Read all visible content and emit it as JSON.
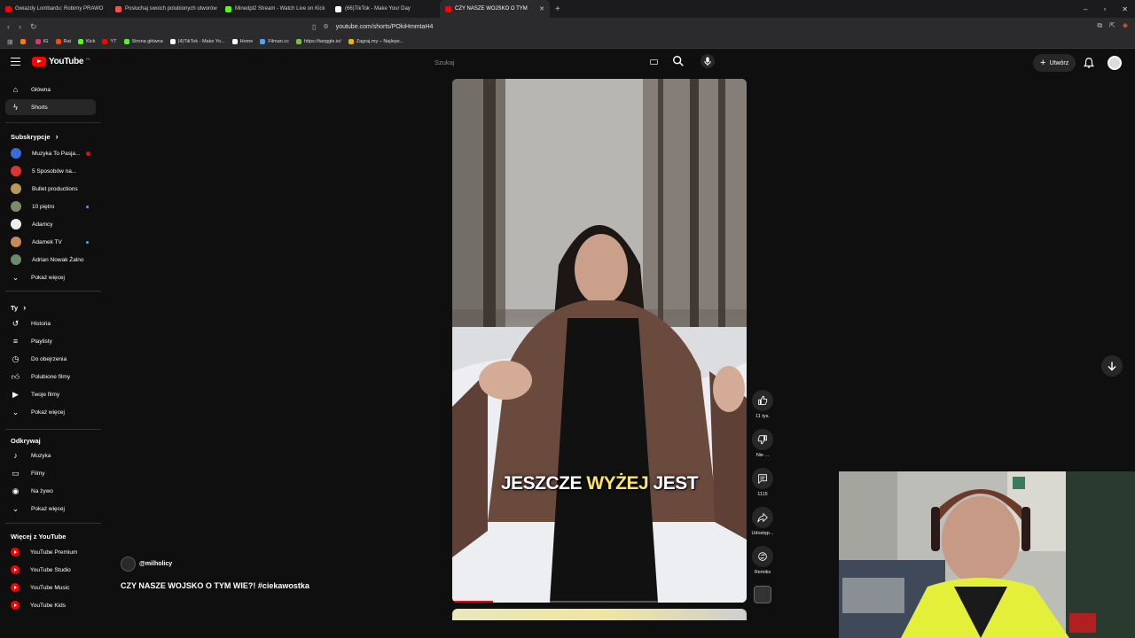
{
  "browser": {
    "tabs": [
      {
        "title": "Gwiazdy Lombardu: Robimy PRAWO",
        "color": "#ff0000"
      },
      {
        "title": "Posłuchaj swoich polubionych utworów",
        "color": "#ff4e45"
      },
      {
        "title": "Minedpl2 Stream - Watch Live on Kick",
        "color": "#53fc18"
      },
      {
        "title": "(66)TikTok - Make Your Day",
        "color": "#ffffff"
      },
      {
        "title": "CZY NASZE WOJSKO O TYM",
        "color": "#ff0000",
        "active": true
      }
    ],
    "url": "youtube.com/shorts/POkiHmmtaH4",
    "bookmarks": [
      {
        "label": "",
        "color": "#ff7a00"
      },
      {
        "label": "IG",
        "color": "#e1306c"
      },
      {
        "label": "Rat",
        "color": "#ff4500"
      },
      {
        "label": "Kick",
        "color": "#53fc18"
      },
      {
        "label": "YT",
        "color": "#ff0000"
      },
      {
        "label": "Strona główna",
        "color": "#53fc18"
      },
      {
        "label": "(4)TikTok - Make Yo...",
        "color": "#ffffff"
      },
      {
        "label": "Home",
        "color": "#ffffff"
      },
      {
        "label": "Filman.cc",
        "color": "#4aa3ff"
      },
      {
        "label": "https://tanggle.io/",
        "color": "#7bc043"
      },
      {
        "label": "Zagraj.my – Najleps...",
        "color": "#f0b400"
      }
    ]
  },
  "youtube": {
    "logo_text": "YouTube",
    "logo_region": "PL",
    "search_placeholder": "Szukaj",
    "create_label": "Utwórz"
  },
  "sidebar": {
    "main": [
      {
        "label": "Główna",
        "icon": "home-icon"
      },
      {
        "label": "Shorts",
        "icon": "shorts-icon",
        "active": true
      }
    ],
    "subs_header": "Subskrypcje",
    "subs": [
      {
        "label": "Muzyka To Pasja...",
        "color": "#3a6bd6",
        "live": true
      },
      {
        "label": "5 Sposobów na...",
        "color": "#d33",
        "live": false
      },
      {
        "label": "Bullet productions",
        "color": "#b79a5a",
        "live": false
      },
      {
        "label": "10 piętro",
        "color": "#7a8a6a",
        "dot": true
      },
      {
        "label": "Adamcy",
        "color": "#eeeeee",
        "live": false
      },
      {
        "label": "Adamek TV",
        "color": "#c88a5a",
        "dot": true
      },
      {
        "label": "Adrian Nowak Żalno",
        "color": "#6a8a6a",
        "live": false
      }
    ],
    "subs_more": "Pokaż więcej",
    "you_header": "Ty",
    "you": [
      {
        "label": "Historia",
        "icon": "history-icon"
      },
      {
        "label": "Playlisty",
        "icon": "playlist-icon"
      },
      {
        "label": "Do obejrzenia",
        "icon": "watch-later-icon"
      },
      {
        "label": "Polubione filmy",
        "icon": "like-icon"
      },
      {
        "label": "Twoje filmy",
        "icon": "your-videos-icon"
      },
      {
        "label": "Pokaż więcej",
        "icon": "chevron-down-icon"
      }
    ],
    "explore_header": "Odkrywaj",
    "explore": [
      {
        "label": "Muzyka",
        "icon": "music-icon"
      },
      {
        "label": "Filmy",
        "icon": "film-icon"
      },
      {
        "label": "Na żywo",
        "icon": "live-icon"
      },
      {
        "label": "Pokaż więcej",
        "icon": "chevron-down-icon"
      }
    ],
    "more_header": "Więcej z YouTube",
    "more": [
      {
        "label": "YouTube Premium"
      },
      {
        "label": "YouTube Studio"
      },
      {
        "label": "YouTube Music"
      },
      {
        "label": "YouTube Kids"
      }
    ]
  },
  "short": {
    "subtitle_a": "JESZCZE",
    "subtitle_b": "WYŻEJ",
    "subtitle_c": "JEST",
    "progress": 0.14,
    "channel": "@milholicy",
    "title": "CZY NASZE WOJSKO O TYM WIE?! #ciekawostka",
    "actions": [
      {
        "label": "11 tys.",
        "icon": "thumb-up-icon"
      },
      {
        "label": "Nie ...",
        "icon": "thumb-down-icon"
      },
      {
        "label": "1115",
        "icon": "comment-icon"
      },
      {
        "label": "Udostęp...",
        "icon": "share-icon"
      },
      {
        "label": "Remiks",
        "icon": "remix-icon"
      }
    ]
  }
}
